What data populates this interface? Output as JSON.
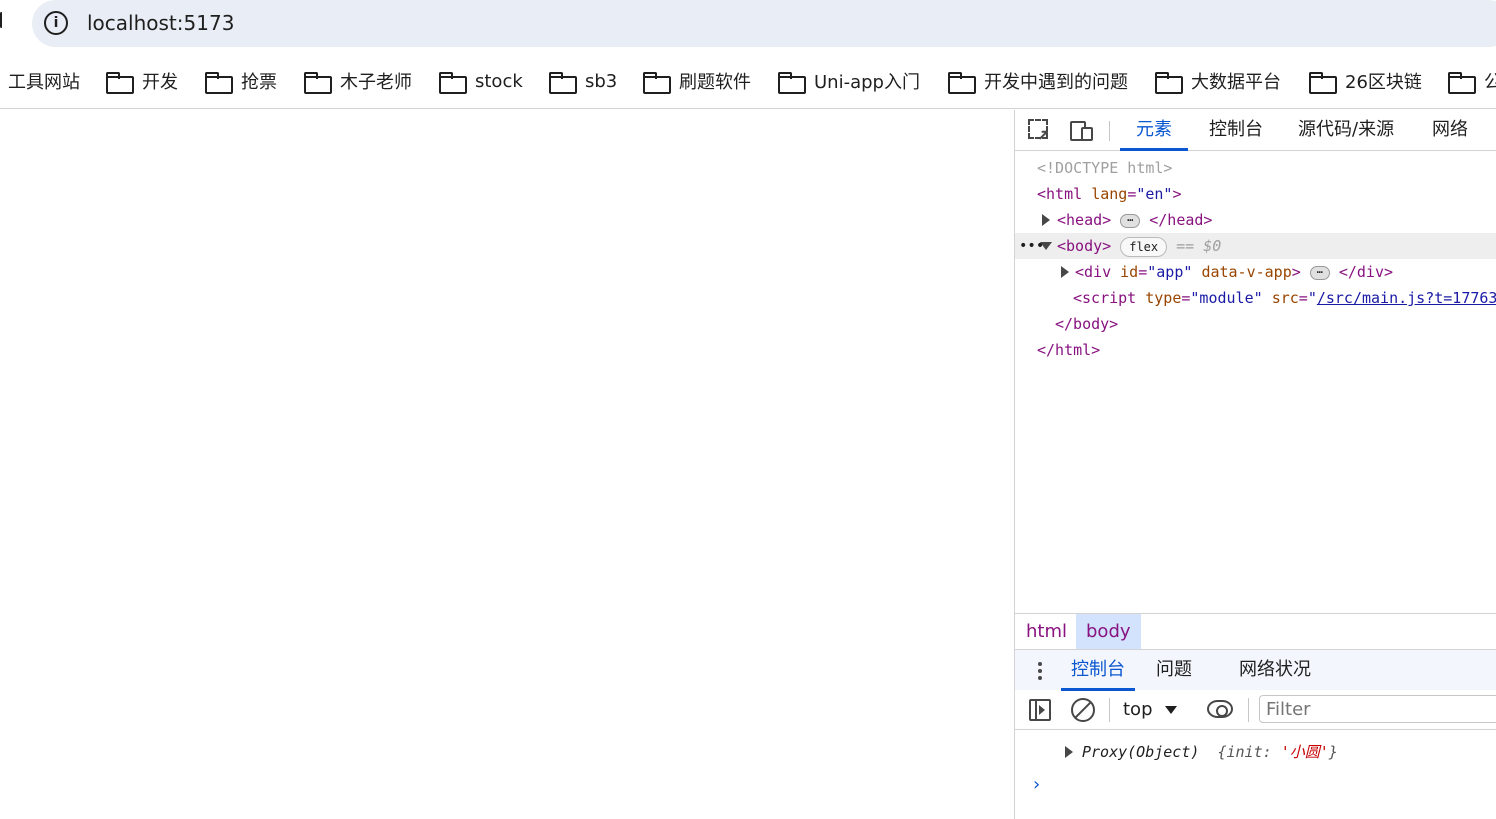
{
  "address_bar": {
    "url": "localhost:5173",
    "info_icon": "info-icon"
  },
  "bookmarks": [
    {
      "label": "工具网站",
      "icon": "none"
    },
    {
      "label": "开发",
      "icon": "folder-icon"
    },
    {
      "label": "抢票",
      "icon": "folder-icon"
    },
    {
      "label": "木子老师",
      "icon": "folder-icon"
    },
    {
      "label": "stock",
      "icon": "folder-icon"
    },
    {
      "label": "sb3",
      "icon": "folder-icon"
    },
    {
      "label": "刷题软件",
      "icon": "folder-icon"
    },
    {
      "label": "Uni-app入门",
      "icon": "folder-icon"
    },
    {
      "label": "开发中遇到的问题",
      "icon": "folder-icon"
    },
    {
      "label": "大数据平台",
      "icon": "folder-icon"
    },
    {
      "label": "26区块链",
      "icon": "folder-icon"
    },
    {
      "label": "公",
      "icon": "folder-icon"
    }
  ],
  "devtools": {
    "tabs": [
      "元素",
      "控制台",
      "源代码/来源",
      "网络"
    ],
    "active_tab": "元素",
    "accent_color": "#0b57d0",
    "elements": {
      "doctype": "<!DOCTYPE html>",
      "html_open_tag": "<html",
      "html_attr_name": "lang",
      "html_attr_value": "\"en\"",
      "html_open_end": ">",
      "head_open": "<head>",
      "head_close": "</head>",
      "ellipsis": "…",
      "body_open": "<body>",
      "body_badge": "flex",
      "body_selected_marker": "== $0",
      "div_open_tag": "<div",
      "div_id_name": "id",
      "div_id_value": "\"app\"",
      "div_attr2": "data-v-app",
      "div_open_end": ">",
      "div_close": "</div>",
      "script_open_tag": "<script",
      "script_type_name": "type",
      "script_type_value": "\"module\"",
      "script_src_name": "src",
      "script_src_quote": "\"",
      "script_src_link": "/src/main.js?t=17763",
      "body_close": "</body>",
      "html_close": "</html>"
    },
    "breadcrumb": [
      "html",
      "body"
    ],
    "drawer": {
      "tabs": [
        "控制台",
        "问题",
        "网络状况"
      ],
      "active_tab": "控制台",
      "context": "top",
      "filter_placeholder": "Filter",
      "filter_value": "",
      "log": {
        "prefix": "Proxy(Object)",
        "open": "{",
        "key": "init",
        "colon": ":",
        "value": "'小圆'",
        "close": "}"
      },
      "prompt": "›"
    }
  }
}
